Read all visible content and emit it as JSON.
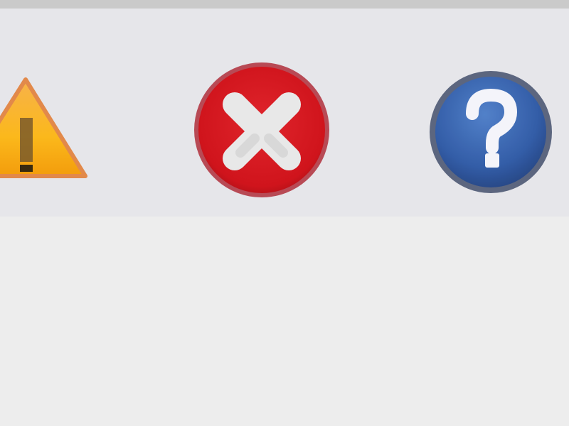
{
  "icons": [
    {
      "name": "warning-icon",
      "color": "#f5a60c"
    },
    {
      "name": "error-icon",
      "color": "#d61f26"
    },
    {
      "name": "help-icon",
      "color": "#2c5aa8"
    }
  ]
}
